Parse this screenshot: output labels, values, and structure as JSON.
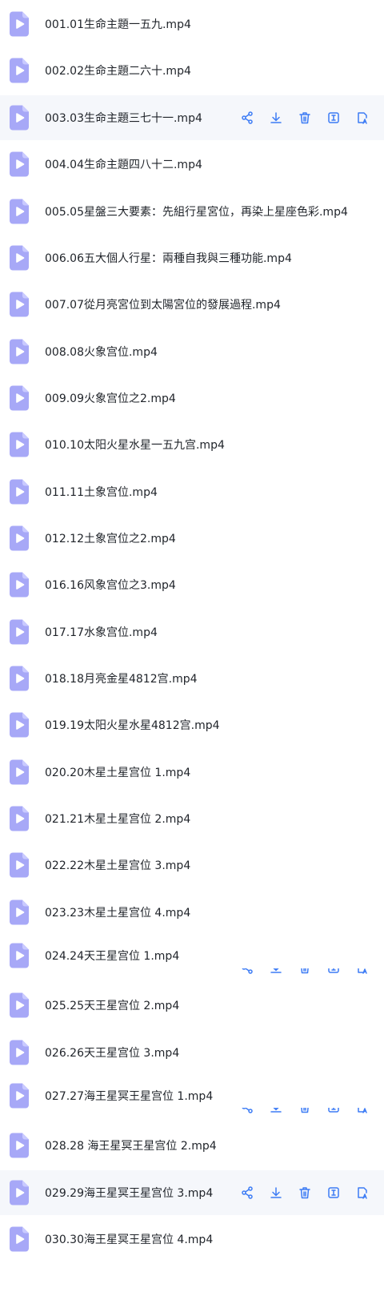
{
  "files": [
    {
      "name": "001.01生命主題一五九.mp4"
    },
    {
      "name": "002.02生命主題二六十.mp4"
    },
    {
      "name": "003.03生命主題三七十一.mp4",
      "state": "hover"
    },
    {
      "name": "004.04生命主題四八十二.mp4"
    },
    {
      "name": "005.05星盤三大要素：先組行星宮位，再染上星座色彩.mp4"
    },
    {
      "name": "006.06五大個人行星：兩種自我與三種功能.mp4"
    },
    {
      "name": "007.07從月亮宮位到太陽宮位的發展過程.mp4"
    },
    {
      "name": "008.08火象宫位.mp4"
    },
    {
      "name": "009.09火象宫位之2.mp4"
    },
    {
      "name": "010.10太阳火星水星一五九宫.mp4"
    },
    {
      "name": "011.11土象宫位.mp4"
    },
    {
      "name": "012.12土象宫位之2.mp4"
    },
    {
      "name": "016.16风象宫位之3.mp4"
    },
    {
      "name": "017.17水象宫位.mp4"
    },
    {
      "name": "018.18月亮金星4812宫.mp4"
    },
    {
      "name": "019.19太阳火星水星4812宫.mp4"
    },
    {
      "name": "020.20木星土星宫位 1.mp4"
    },
    {
      "name": "021.21木星土星宫位 2.mp4"
    },
    {
      "name": "022.22木星土星宫位 3.mp4"
    },
    {
      "name": "023.23木星土星宫位 4.mp4"
    },
    {
      "name": "024.24天王星宫位 1.mp4",
      "state": "partial-hover"
    },
    {
      "name": "025.25天王星宫位 2.mp4"
    },
    {
      "name": "026.26天王星宫位 3.mp4"
    },
    {
      "name": "027.27海王星冥王星宫位 1.mp4",
      "state": "partial-hover"
    },
    {
      "name": "028.28 海王星冥王星宫位 2.mp4"
    },
    {
      "name": "029.29海王星冥王星宫位 3.mp4",
      "state": "hover"
    },
    {
      "name": "030.30海王星冥王星宫位 4.mp4"
    }
  ],
  "row_actions": [
    "share-icon",
    "download-icon",
    "delete-icon",
    "rename-icon",
    "more-icon"
  ],
  "colors": {
    "accent": "#3d7cf5",
    "file_icon": "#a7a8f7",
    "hover_bg": "#f5f7fb",
    "text": "#1f2329"
  }
}
